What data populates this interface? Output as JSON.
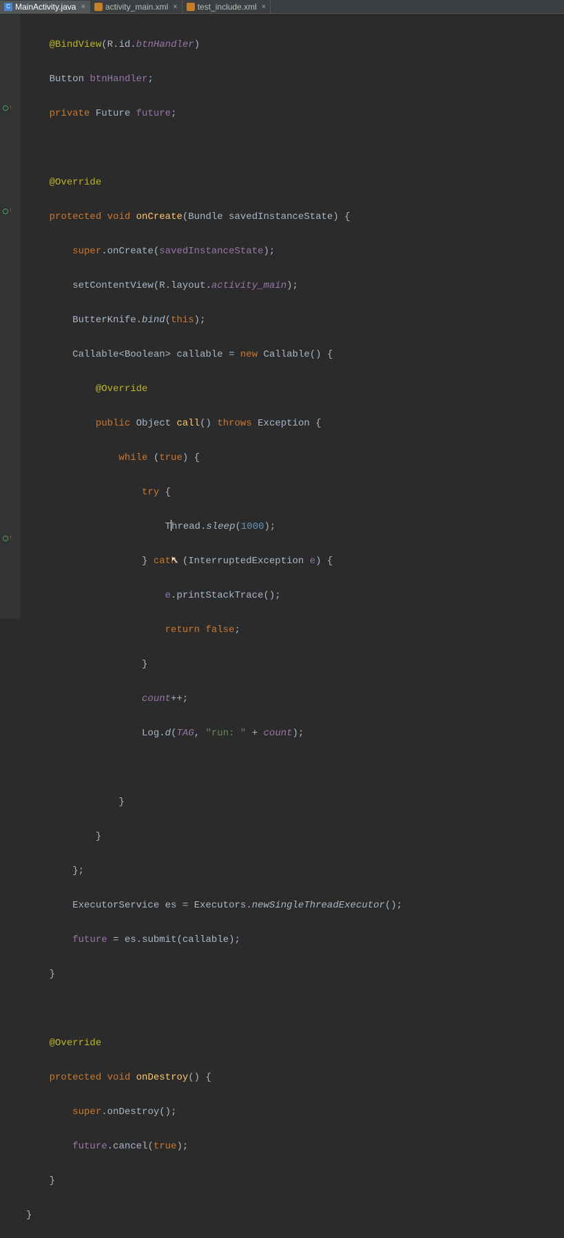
{
  "tabs": [
    {
      "name": "MainActivity.java",
      "type": "java",
      "iconLetter": "C",
      "active": true
    },
    {
      "name": "activity_main.xml",
      "type": "xml",
      "iconLetter": "",
      "active": false
    },
    {
      "name": "test_include.xml",
      "type": "xml",
      "iconLetter": "",
      "active": false
    }
  ],
  "tokens": {
    "ann_BindView": "@BindView",
    "R": "R",
    "id": "id",
    "btnHandler_field": "btnHandler",
    "Button": "Button",
    "btnHandler_var": "btnHandler",
    "semi": ";",
    "private": "private",
    "Future": "Future",
    "future": "future",
    "ann_Override": "@Override",
    "protected": "protected",
    "void": "void",
    "onCreate": "onCreate",
    "Bundle": "Bundle",
    "savedInstanceState": "savedInstanceState",
    "super": "super",
    "setContentView": "setContentView",
    "layout": "layout",
    "activity_main": "activity_main",
    "ButterKnife": "ButterKnife",
    "bind": "bind",
    "this": "this",
    "Callable": "Callable",
    "Boolean": "Boolean",
    "callable": "callable",
    "new": "new",
    "public": "public",
    "Object": "Object",
    "call": "call",
    "throws": "throws",
    "Exception": "Exception",
    "while": "while",
    "true": "true",
    "try": "try",
    "Thread": "Thread",
    "sleep": "sleep",
    "thousand": "1000",
    "catch": "catch",
    "InterruptedException": "InterruptedException",
    "e": "e",
    "printStackTrace": "printStackTrace",
    "return": "return",
    "false": "false",
    "count": "count",
    "plusplus": "++",
    "Log": "Log",
    "d": "d",
    "TAG": "TAG",
    "runstr": "\"run: \"",
    "plus": "+",
    "ExecutorService": "ExecutorService",
    "es": "es",
    "Executors": "Executors",
    "newSingleThreadExecutor": "newSingleThreadExecutor",
    "submit": "submit",
    "onDestroy": "onDestroy",
    "cancel": "cancel"
  },
  "gutter_markers": [
    {
      "topPx": 133
    },
    {
      "topPx": 283
    },
    {
      "topPx": 758
    }
  ]
}
